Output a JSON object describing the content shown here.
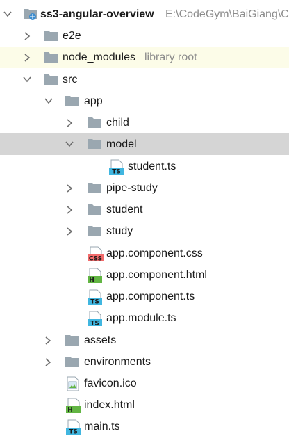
{
  "tree": {
    "root": {
      "name": "ss3-angular-overview",
      "path": "E:\\CodeGym\\BaiGiang\\C"
    },
    "nodes": [
      {
        "name": "e2e",
        "type": "folder",
        "chevron": "collapsed"
      },
      {
        "name": "node_modules",
        "hint": "library root",
        "type": "folder",
        "chevron": "collapsed"
      },
      {
        "name": "src",
        "type": "folder",
        "chevron": "expanded"
      },
      {
        "name": "app",
        "type": "folder",
        "chevron": "expanded"
      },
      {
        "name": "child",
        "type": "folder",
        "chevron": "collapsed"
      },
      {
        "name": "model",
        "type": "folder",
        "chevron": "expanded"
      },
      {
        "name": "student.ts",
        "type": "file",
        "badge": "TS"
      },
      {
        "name": "pipe-study",
        "type": "folder",
        "chevron": "collapsed"
      },
      {
        "name": "student",
        "type": "folder",
        "chevron": "collapsed"
      },
      {
        "name": "study",
        "type": "folder",
        "chevron": "collapsed"
      },
      {
        "name": "app.component.css",
        "type": "file",
        "badge": "CSS"
      },
      {
        "name": "app.component.html",
        "type": "file",
        "badge": "H"
      },
      {
        "name": "app.component.ts",
        "type": "file",
        "badge": "TS"
      },
      {
        "name": "app.module.ts",
        "type": "file",
        "badge": "TS"
      },
      {
        "name": "assets",
        "type": "folder",
        "chevron": "collapsed"
      },
      {
        "name": "environments",
        "type": "folder",
        "chevron": "collapsed"
      },
      {
        "name": "favicon.ico",
        "type": "file"
      },
      {
        "name": "index.html",
        "type": "file",
        "badge": "H"
      },
      {
        "name": "main.ts",
        "type": "file",
        "badge": "TS"
      }
    ]
  },
  "colors": {
    "folder": "#9aa7b0",
    "ts_badge": "#40b6e0",
    "css_badge": "#f26b6b",
    "html_badge": "#62b543",
    "library_highlight": "#fcfce8",
    "selection": "#d5d5d5"
  }
}
